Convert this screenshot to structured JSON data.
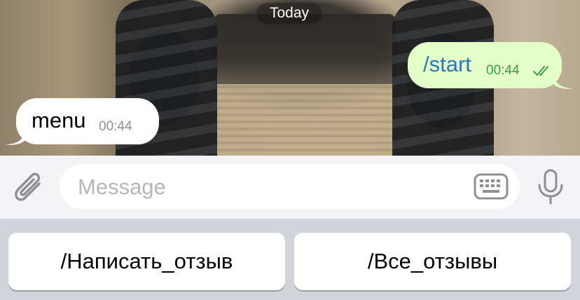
{
  "chat": {
    "date_label": "Today",
    "messages": [
      {
        "direction": "outgoing",
        "text": "/start",
        "time": "00:44",
        "status": "read"
      },
      {
        "direction": "incoming",
        "text": "menu",
        "time": "00:44"
      }
    ]
  },
  "input": {
    "placeholder": "Message",
    "icons": {
      "attach": "paperclip-icon",
      "keyboard": "keyboard-icon",
      "mic": "microphone-icon"
    }
  },
  "reply_keyboard": {
    "buttons": [
      "/Написать_отзыв",
      "/Все_отзывы"
    ]
  },
  "colors": {
    "outgoing_bubble": "#e3fec6",
    "outgoing_text": "#2a77bd",
    "outgoing_time": "#3c9e43",
    "incoming_bubble": "#ffffff"
  }
}
